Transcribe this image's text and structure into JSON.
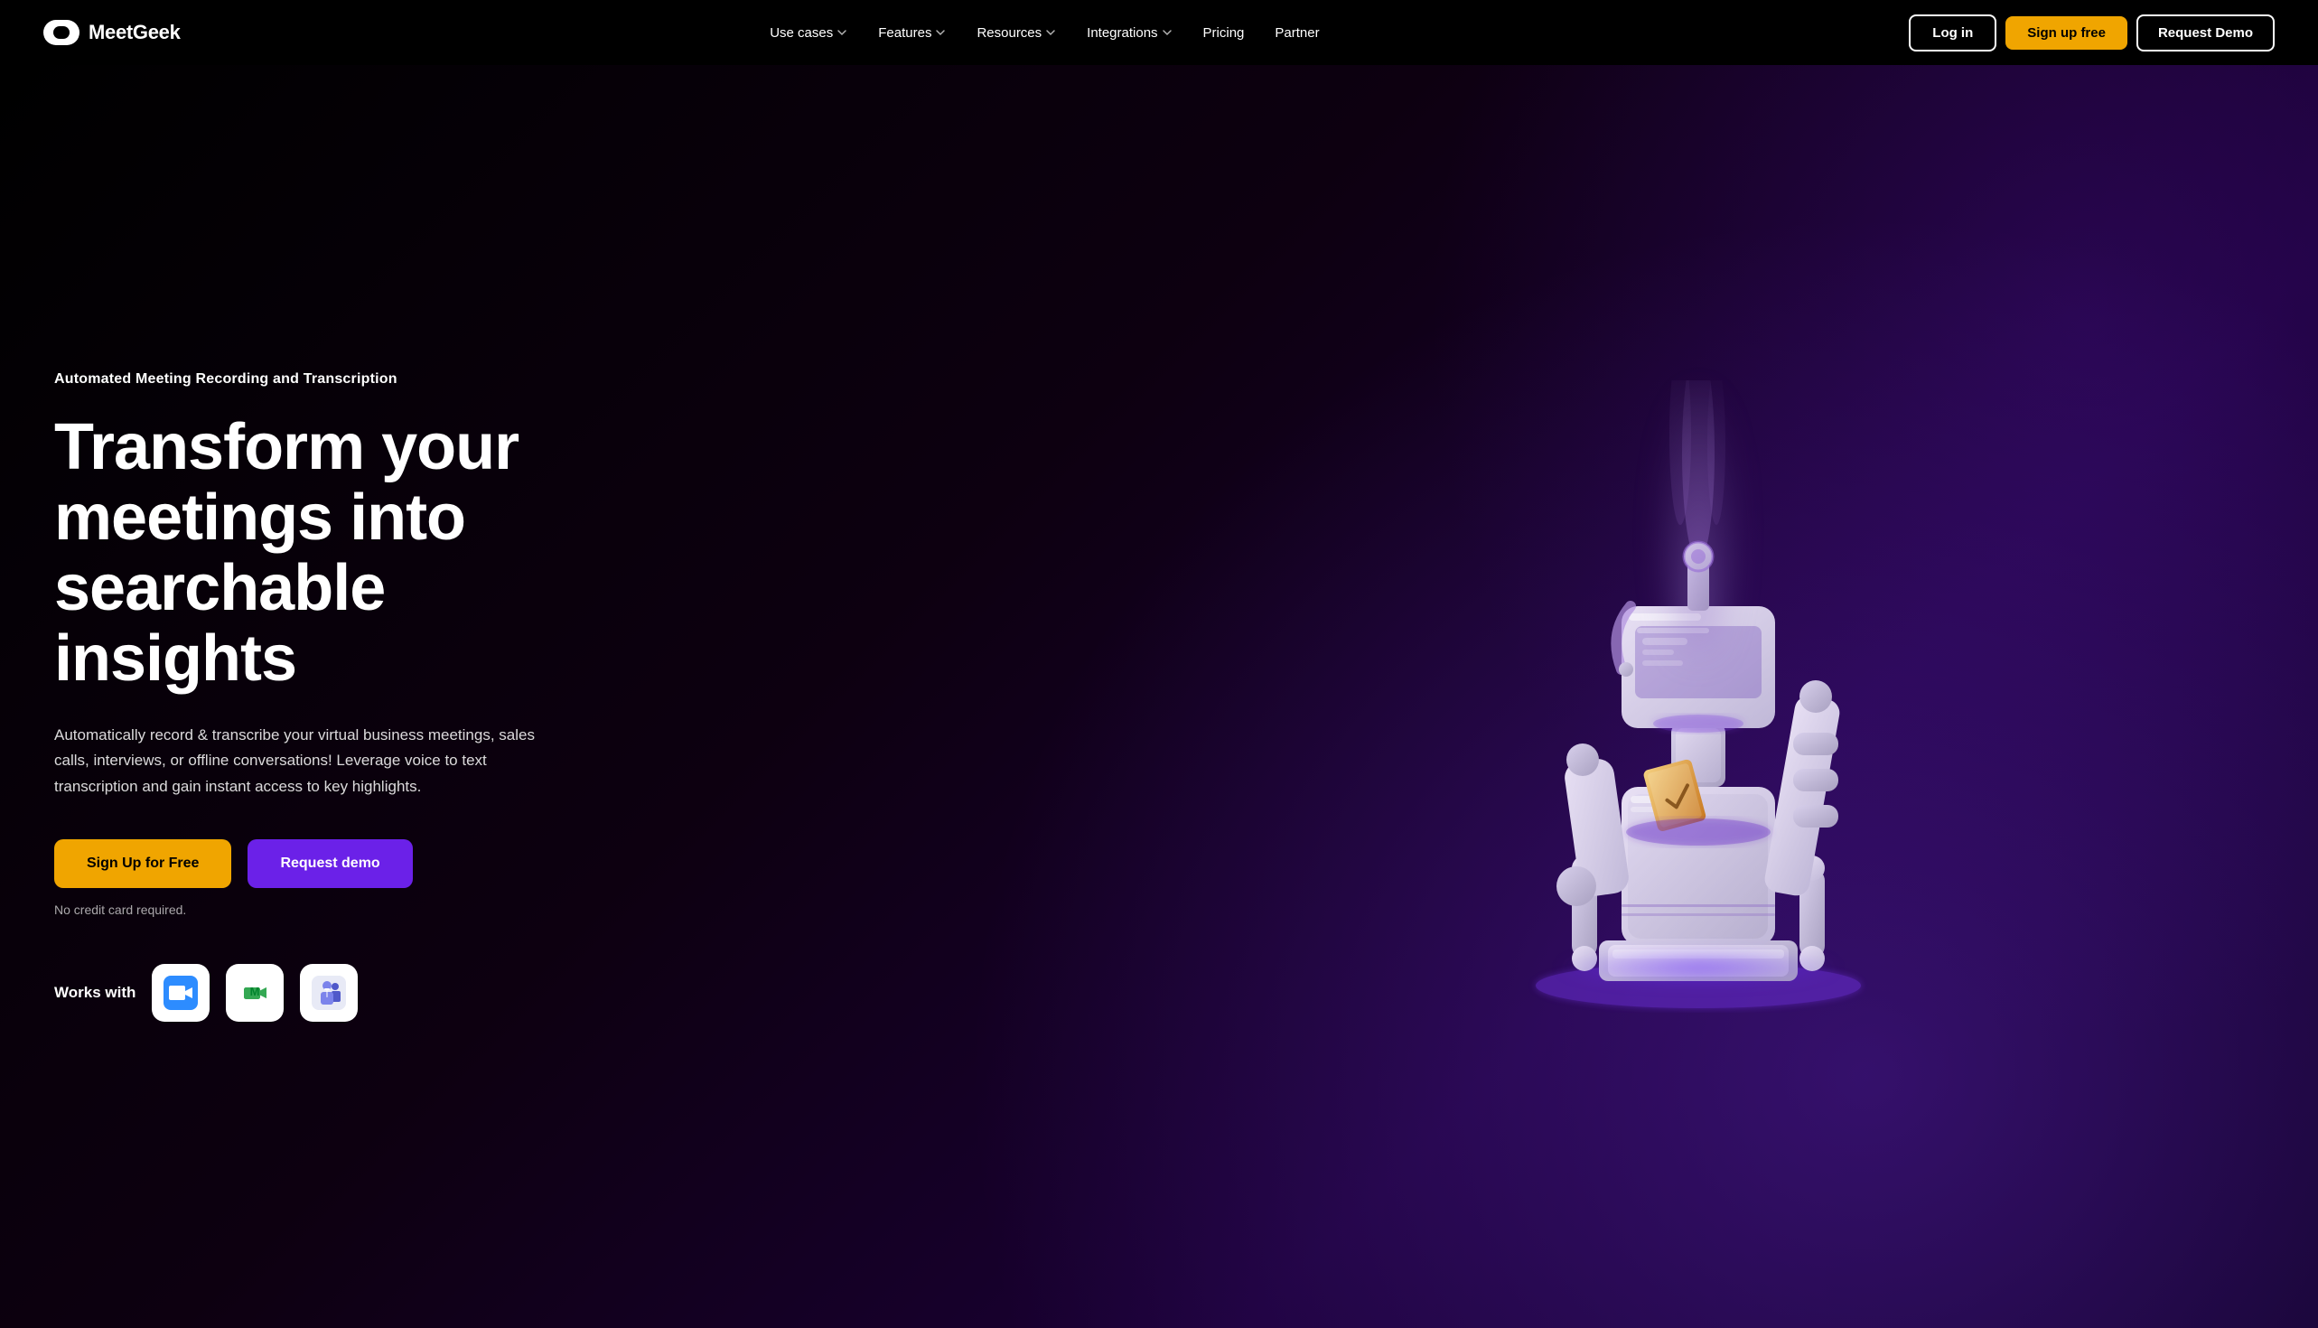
{
  "brand": {
    "name": "MeetGeek",
    "logo_alt": "MeetGeek logo"
  },
  "nav": {
    "links": [
      {
        "label": "Use cases",
        "has_dropdown": true
      },
      {
        "label": "Features",
        "has_dropdown": true
      },
      {
        "label": "Resources",
        "has_dropdown": true
      },
      {
        "label": "Integrations",
        "has_dropdown": true
      },
      {
        "label": "Pricing",
        "has_dropdown": false
      },
      {
        "label": "Partner",
        "has_dropdown": false
      }
    ],
    "login_label": "Log in",
    "signup_label": "Sign up free",
    "demo_label": "Request Demo"
  },
  "hero": {
    "subtitle": "Automated Meeting Recording and Transcription",
    "title": "Transform your meetings into searchable insights",
    "description": "Automatically record & transcribe your virtual business meetings, sales calls, interviews, or offline conversations! Leverage voice to text transcription and gain instant access to key highlights.",
    "cta_primary": "Sign Up for Free",
    "cta_secondary": "Request demo",
    "no_credit_card": "No credit card required.",
    "works_with_label": "Works with",
    "integrations": [
      {
        "name": "Zoom",
        "icon": "zoom"
      },
      {
        "name": "Google Meet",
        "icon": "meet"
      },
      {
        "name": "Microsoft Teams",
        "icon": "teams"
      }
    ]
  },
  "colors": {
    "accent_yellow": "#f0a500",
    "accent_purple": "#6b21e8",
    "nav_border": "#ffffff",
    "bg_dark": "#000000"
  }
}
